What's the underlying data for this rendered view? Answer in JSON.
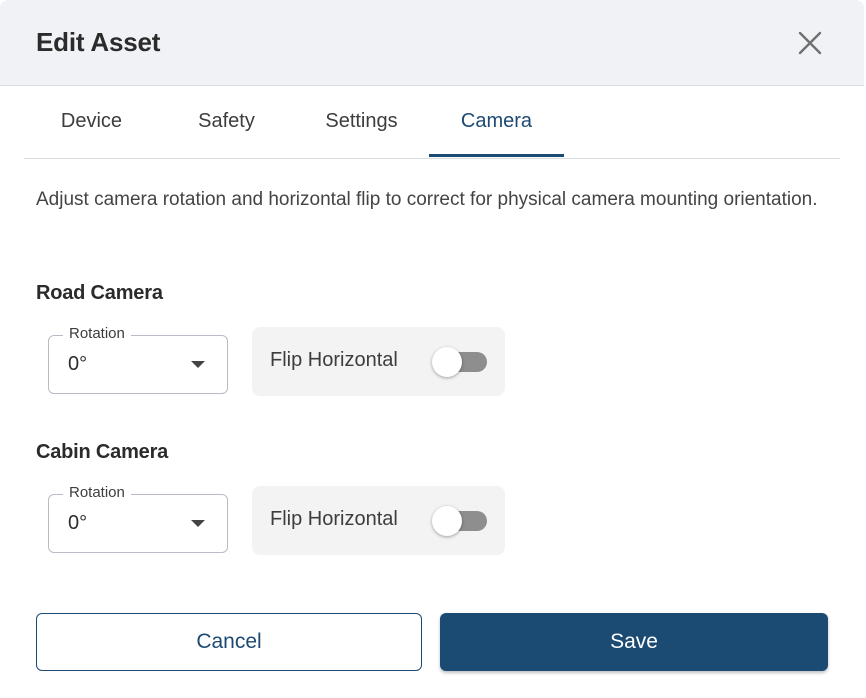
{
  "dialog": {
    "title": "Edit Asset"
  },
  "tabs": [
    {
      "label": "Device",
      "active": false
    },
    {
      "label": "Safety",
      "active": false
    },
    {
      "label": "Settings",
      "active": false
    },
    {
      "label": "Camera",
      "active": true
    }
  ],
  "description": "Adjust camera rotation and horizontal flip to correct for physical camera mounting orientation.",
  "road_camera": {
    "title": "Road Camera",
    "rotation_label": "Rotation",
    "rotation_value": "0°",
    "flip_label": "Flip Horizontal",
    "flip_enabled": false
  },
  "cabin_camera": {
    "title": "Cabin Camera",
    "rotation_label": "Rotation",
    "rotation_value": "0°",
    "flip_label": "Flip Horizontal",
    "flip_enabled": false
  },
  "actions": {
    "cancel_label": "Cancel",
    "save_label": "Save"
  },
  "colors": {
    "accent": "#1d4a72",
    "header_bg": "#f1f2f6",
    "toggle_off": "#8e8e8e"
  },
  "icons": {
    "close": "close-icon",
    "dropdown": "caret-down-icon"
  }
}
